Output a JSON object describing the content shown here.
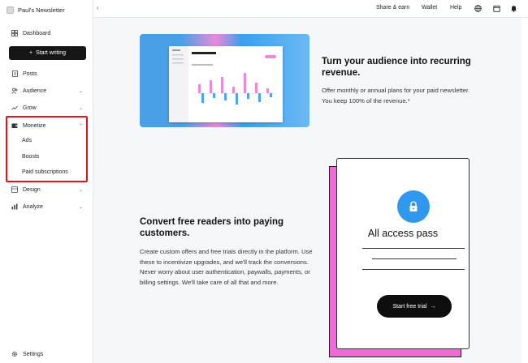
{
  "sidebar": {
    "publication_name": "Paul's Newsletter",
    "dashboard": "Dashboard",
    "start_writing": "Start writing",
    "posts": "Posts",
    "audience": "Audience",
    "grow": "Grow",
    "monetize": "Monetize",
    "monetize_items": [
      "Ads",
      "Boosts",
      "Paid subscriptions"
    ],
    "design": "Design",
    "analyze": "Analyze",
    "settings": "Settings"
  },
  "topbar": {
    "share_earn": "Share & earn",
    "wallet": "Wallet",
    "help": "Help",
    "icons": [
      "globe-icon",
      "calendar-icon",
      "bell-icon"
    ]
  },
  "section1": {
    "title": "Turn your audience into recurring revenue.",
    "body": "Offer monthly or annual plans for your paid newsletter. You keep 100% of the revenue.*"
  },
  "section2": {
    "title": "Convert free readers into paying customers.",
    "body": "Create custom offers and free trials directly in the platform. Use these to incentivize upgrades, and we'll track the conversions. Never worry about user authentication, paywalls, payments, or billing settings. We'll take care of all that and more."
  },
  "pass_card": {
    "title": "All access pass",
    "button": "Start free trial"
  },
  "colors": {
    "highlight": "#e4121b",
    "accent_blue": "#2f97ec",
    "accent_pink": "#ef6ad6"
  }
}
